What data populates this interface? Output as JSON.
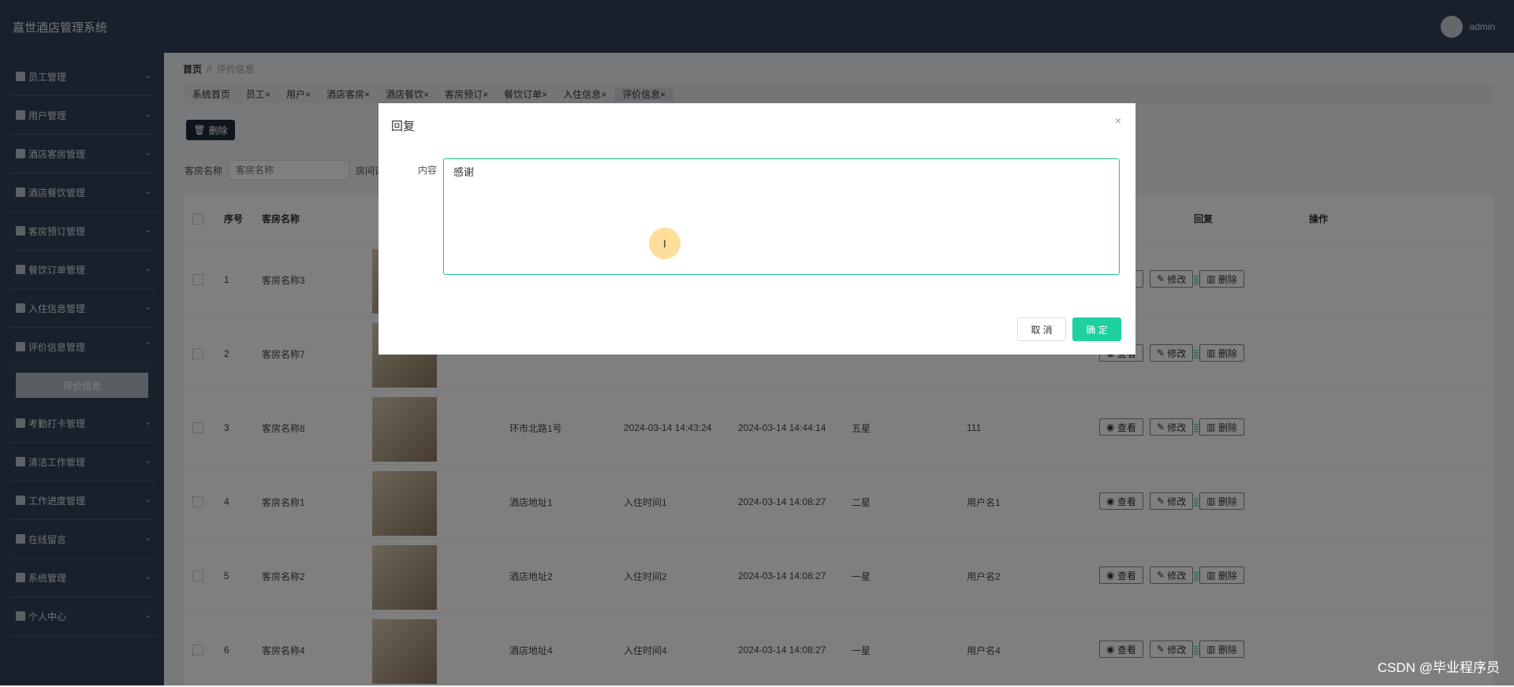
{
  "app": {
    "title": "嘉世酒店管理系统",
    "user": "admin"
  },
  "sidebar": {
    "items": [
      {
        "label": "员工管理",
        "icon": "briefcase-icon"
      },
      {
        "label": "用户管理",
        "icon": "chat-icon"
      },
      {
        "label": "酒店客房管理",
        "icon": "grid-icon"
      },
      {
        "label": "酒店餐饮管理",
        "icon": "document-icon"
      },
      {
        "label": "客房预订管理",
        "icon": "bar-chart-icon"
      },
      {
        "label": "餐饮订单管理",
        "icon": "list-icon"
      },
      {
        "label": "入住信息管理",
        "icon": "grid-icon"
      },
      {
        "label": "评价信息管理",
        "icon": "columns-icon",
        "expanded": true,
        "sub": "评价信息"
      },
      {
        "label": "考勤打卡管理",
        "icon": "grid-icon"
      },
      {
        "label": "清洁工作管理",
        "icon": "shield-icon"
      },
      {
        "label": "工作进度管理",
        "icon": "briefcase-icon"
      },
      {
        "label": "在线留言",
        "icon": "user-icon"
      },
      {
        "label": "系统管理",
        "icon": "sliders-icon"
      },
      {
        "label": "个人中心",
        "icon": "window-icon"
      }
    ]
  },
  "breadcrumb": {
    "home": "首页",
    "current": "评价信息"
  },
  "tags": [
    "系统首页",
    "员工",
    "用户",
    "酒店客房",
    "酒店餐饮",
    "客房预订",
    "餐饮订单",
    "入住信息",
    "评价信息"
  ],
  "toolbar": {
    "delete_label": "删除"
  },
  "search": {
    "label1": "客房名称",
    "placeholder1": "客房名称",
    "label2": "房间评分"
  },
  "table": {
    "headers": {
      "index": "序号",
      "name": "客房名称",
      "reply": "回复",
      "ops": "操作"
    },
    "reply_text": "回复",
    "ops": {
      "view": "查看",
      "edit": "修改",
      "delete": "删除"
    },
    "rows": [
      {
        "idx": "1",
        "name": "客房名称3",
        "address": "",
        "checkin": "",
        "time": "",
        "rating": "",
        "user": ""
      },
      {
        "idx": "2",
        "name": "客房名称7",
        "address": "",
        "checkin": "",
        "time": "",
        "rating": "",
        "user": ""
      },
      {
        "idx": "3",
        "name": "客房名称8",
        "address": "环市北路1号",
        "checkin": "2024-03-14 14:43:24",
        "time": "2024-03-14 14:44:14",
        "rating": "五星",
        "user": "111"
      },
      {
        "idx": "4",
        "name": "客房名称1",
        "address": "酒店地址1",
        "checkin": "入住时间1",
        "time": "2024-03-14 14:08:27",
        "rating": "二星",
        "user": "用户名1"
      },
      {
        "idx": "5",
        "name": "客房名称2",
        "address": "酒店地址2",
        "checkin": "入住时间2",
        "time": "2024-03-14 14:08:27",
        "rating": "一星",
        "user": "用户名2"
      },
      {
        "idx": "6",
        "name": "客房名称4",
        "address": "酒店地址4",
        "checkin": "入住时间4",
        "time": "2024-03-14 14:08:27",
        "rating": "一星",
        "user": "用户名4"
      }
    ]
  },
  "dialog": {
    "title": "回复",
    "close": "×",
    "field_label": "内容",
    "content": "感谢",
    "cancel": "取 消",
    "ok": "确 定"
  },
  "watermark": "CSDN @毕业程序员"
}
